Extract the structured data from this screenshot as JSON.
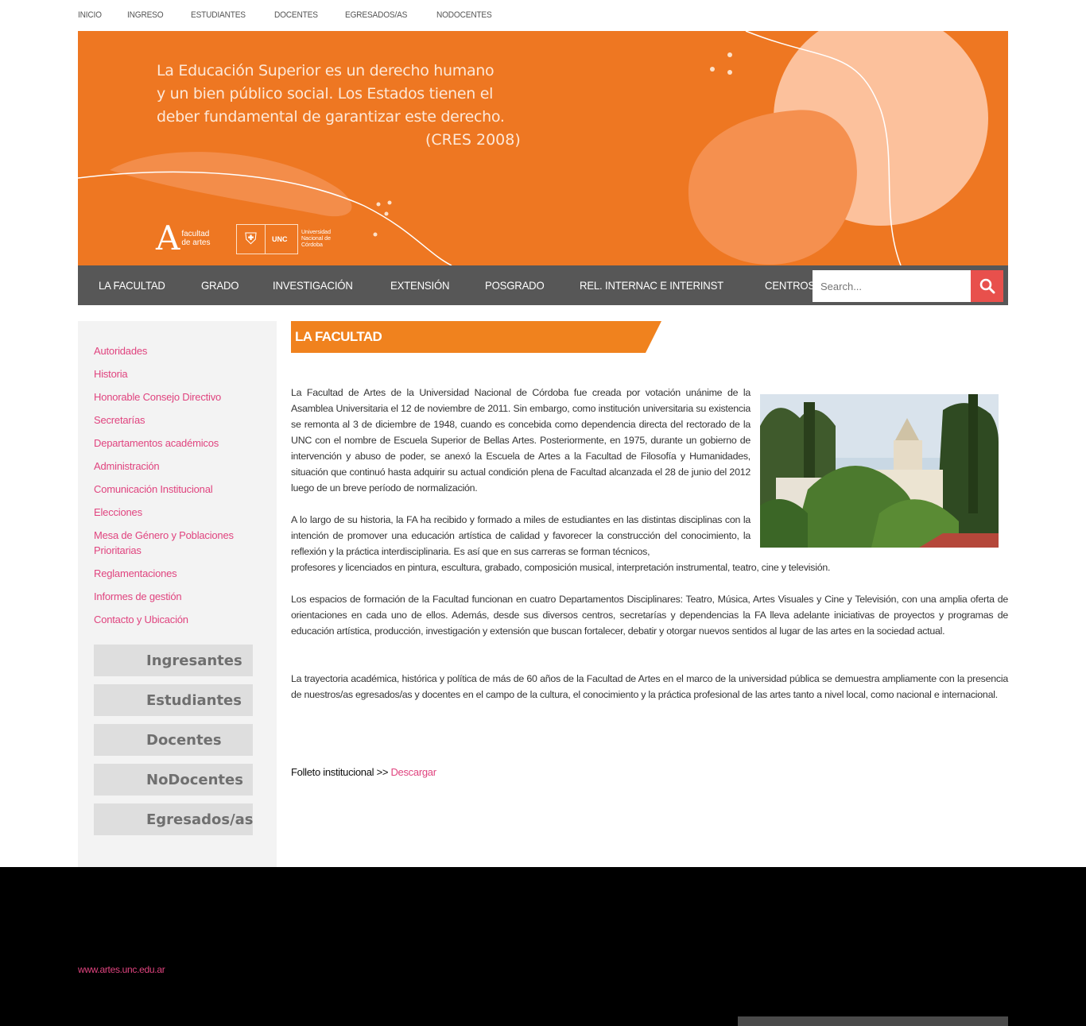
{
  "top_nav": [
    "INICIO",
    "INGRESO",
    "ESTUDIANTES",
    "DOCENTES",
    "EGRESADOS/AS",
    "NODOCENTES"
  ],
  "banner": {
    "quote_lines": [
      "La Educación Superior es un derecho humano",
      "y un bien público social. Los Estados tienen el",
      "deber fundamental de garantizar este derecho."
    ],
    "quote_source": "(CRES 2008)",
    "logo_fa": "facultad de artes",
    "logo_unc_abbr": "UNC",
    "logo_unc_name": "Universidad Nacional de Córdoba",
    "color": "#ee7722"
  },
  "main_nav": [
    "LA FACULTAD",
    "GRADO",
    "INVESTIGACIÓN",
    "EXTENSIÓN",
    "POSGRADO",
    "REL. INTERNAC E INTERINST",
    "CENTROS"
  ],
  "search": {
    "placeholder": "Search...",
    "icon": "search-icon",
    "button_color": "#e8504c"
  },
  "sidebar": {
    "links": [
      "Autoridades",
      "Historia",
      "Honorable Consejo Directivo",
      "Secretarías",
      "Departamentos académicos",
      "Administración",
      "Comunicación Institucional",
      "Elecciones",
      "Mesa de Género y Poblaciones Prioritarias",
      "Reglamentaciones",
      "Informes de gestión",
      "Contacto y Ubicación"
    ],
    "quick_buttons": [
      "Ingresantes",
      "Estudiantes",
      "Docentes",
      "NoDocentes",
      "Egresados/as"
    ]
  },
  "page": {
    "title": "LA FACULTAD",
    "paragraphs": [
      "La Facultad de Artes de la Universidad Nacional de Córdoba fue creada por votación unánime de la Asamblea Universitaria el 12 de noviembre de 2011. Sin embargo, como institución universitaria su existencia se remonta al 3 de diciembre de 1948, cuando es concebida como dependencia directa del rectorado de la UNC con el nombre de Escuela Superior de Bellas Artes. Posteriormente, en 1975, durante un gobierno de intervención y abuso de poder, se anexó la Escuela de Artes a la Facultad de Filosofía y Humanidades, situación que continuó hasta adquirir su actual condición  plena de  Facultad alcanzada el 28 de junio del 2012 luego de un breve período de normalización.",
      "A lo largo de su historia, la FA ha recibido y formado a miles de estudiantes en las distintas disciplinas con la intención de promover una educación artística de calidad y favorecer la construcción del conocimiento, la reflexión y la práctica interdisciplinaria. Es así que en sus carreras se forman  técnicos, profesores y licenciados en pintura, escultura, grabado, composición musical, interpretación instrumental, teatro, cine y televisión.",
      "Los espacios de formación de la Facultad funcionan en cuatro Departamentos Disciplinares: Teatro, Música, Artes Visuales y Cine y Televisión, con una amplia oferta de orientaciones en cada uno de ellos. Además, desde sus diversos centros, secretarías y dependencias la FA lleva adelante iniciativas de proyectos y programas de educación artística, producción, investigación y extensión que buscan fortalecer, debatir y otorgar nuevos sentidos al lugar de las artes en la sociedad actual.",
      "La trayectoria académica, histórica y política de más de 60 años de la Facultad  de Artes en el marco de la universidad pública se demuestra ampliamente con la presencia de nuestros/as egresados/as y docentes en el campo de la cultura, el conocimiento y la práctica profesional de las artes tanto a nivel local, como nacional e internacional."
    ],
    "p2_wrapped_part": "A lo largo de su historia, la FA ha recibido y formado a miles de estudiantes en las distintas disciplinas con la intención de promover una educación artística de calidad y favorecer la construcción del conocimiento, la reflexión y la práctica interdisciplinaria. Es así que en sus carreras se forman  técnicos,",
    "p2_rest_part": "profesores y licenciados en pintura, escultura, grabado, composición musical, interpretación instrumental, teatro, cine y televisión.",
    "folleto_label": "Folleto institucional >> ",
    "folleto_link": "Descargar",
    "heading_color": "#f0821e",
    "link_color": "#e0447f"
  },
  "footer": {
    "url": "www.artes.unc.edu.ar"
  }
}
